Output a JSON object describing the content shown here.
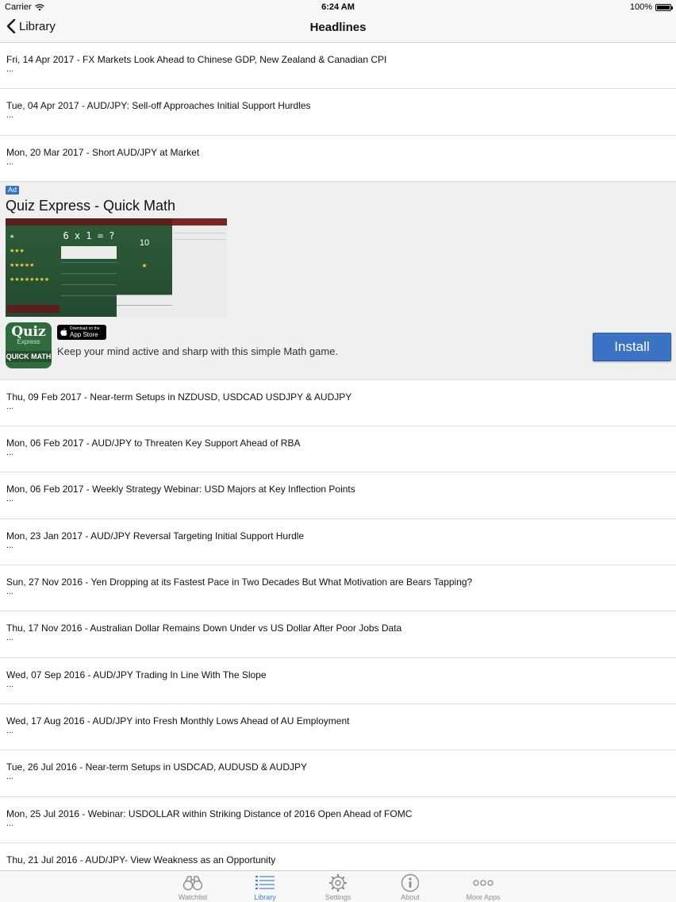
{
  "status": {
    "carrier": "Carrier",
    "time": "6:24 AM",
    "battery": "100%"
  },
  "nav": {
    "back_label": "Library",
    "title": "Headlines"
  },
  "headlines_top": [
    {
      "title": "Fri, 14 Apr 2017 - FX Markets Look Ahead to Chinese GDP, New Zealand & Canadian CPI",
      "excerpt": "..."
    },
    {
      "title": "Tue, 04 Apr 2017 - AUD/JPY: Sell-off Approaches Initial Support Hurdles",
      "excerpt": "..."
    },
    {
      "title": "Mon, 20 Mar 2017 - Short AUD/JPY at Market",
      "excerpt": "..."
    }
  ],
  "ad": {
    "badge": "Ad",
    "title": "Quiz Express - Quick Math",
    "icon_line1": "Quiz",
    "icon_line2": "Express",
    "icon_line3": "QUICK MATH",
    "store_small": "Download on the",
    "store_big": "App Store",
    "description": "Keep your mind active and sharp with this simple Math game.",
    "install_label": "Install",
    "screen_equation": "6 x 1 = ?",
    "screen_score": "10"
  },
  "headlines_bottom": [
    {
      "title": "Thu, 09 Feb 2017 - Near-term Setups in NZDUSD, USDCAD USDJPY & AUDJPY",
      "excerpt": "..."
    },
    {
      "title": "Mon, 06 Feb 2017 - AUD/JPY to Threaten Key Support Ahead of RBA",
      "excerpt": "..."
    },
    {
      "title": "Mon, 06 Feb 2017 - Weekly Strategy Webinar: USD Majors at Key Inflection Points",
      "excerpt": "..."
    },
    {
      "title": "Mon, 23 Jan 2017 - AUD/JPY Reversal Targeting Initial Support Hurdle",
      "excerpt": "..."
    },
    {
      "title": "Sun, 27 Nov 2016 - Yen Dropping at its Fastest Pace in Two Decades But What Motivation are Bears Tapping?",
      "excerpt": "..."
    },
    {
      "title": "Thu, 17 Nov 2016 - Australian Dollar Remains Down Under vs US Dollar After Poor Jobs Data",
      "excerpt": "..."
    },
    {
      "title": "Wed, 07 Sep 2016 - AUD/JPY Trading In Line With The Slope",
      "excerpt": "..."
    },
    {
      "title": "Wed, 17 Aug 2016 - AUD/JPY into Fresh Monthly Lows Ahead of AU Employment",
      "excerpt": "..."
    },
    {
      "title": "Tue, 26 Jul 2016 - Near-term Setups in USDCAD, AUDUSD & AUDJPY",
      "excerpt": "..."
    },
    {
      "title": "Mon, 25 Jul 2016 - Webinar: USDOLLAR within Striking Distance of 2016 Open Ahead of FOMC",
      "excerpt": "..."
    },
    {
      "title": "Thu, 21 Jul 2016 - AUD/JPY- View Weakness as an Opportunity",
      "excerpt": ""
    }
  ],
  "tabs": [
    {
      "label": "Watchlist",
      "icon": "binoculars-icon"
    },
    {
      "label": "Library",
      "icon": "list-icon",
      "active": true
    },
    {
      "label": "Settings",
      "icon": "gear-icon"
    },
    {
      "label": "About",
      "icon": "info-icon"
    },
    {
      "label": "More Apps",
      "icon": "more-icon"
    }
  ],
  "colors": {
    "accent": "#3b82d6",
    "install": "#3b72c4",
    "ad_background": "#f0f0f0"
  }
}
